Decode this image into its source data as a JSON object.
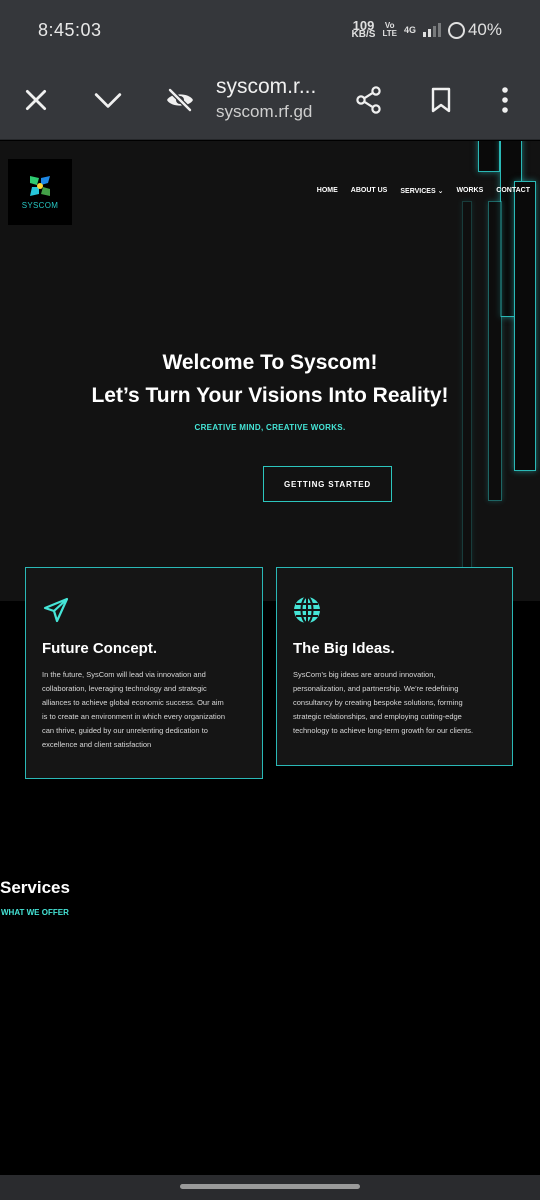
{
  "status_bar": {
    "time": "8:45:03",
    "speed_value": "109",
    "speed_unit": "KB/S",
    "volte_top": "Vo",
    "volte_bottom": "LTE",
    "network": "4G",
    "battery": "40%"
  },
  "browser": {
    "page_title": "syscom.r...",
    "host": "syscom.rf.gd",
    "icons": [
      "close-icon",
      "chevron-down-icon",
      "eye-off-icon",
      "share-icon",
      "bookmark-icon",
      "more-vert-icon"
    ]
  },
  "site": {
    "logo_text": "SYSCOM",
    "nav": [
      "HOME",
      "ABOUT US",
      "SERVICES ⌄",
      "WORKS",
      "CONTACT"
    ],
    "hero": {
      "line1": "Welcome To Syscom!",
      "line2": "Let’s Turn Your Visions Into Reality!",
      "tagline": "CREATIVE MIND, CREATIVE WORKS.",
      "cta": "GETTING STARTED"
    },
    "cards": [
      {
        "icon": "paper-plane-icon",
        "title": "Future Concept.",
        "lines": [
          "In the future, SysCom will lead via innovation and",
          "collaboration, leveraging technology and strategic",
          "alliances to achieve global economic success. Our aim",
          "is to create an environment in which every organization",
          "can thrive, guided by our unrelenting dedication to",
          "excellence and client satisfaction"
        ]
      },
      {
        "icon": "globe-icon",
        "title": "The Big Ideas.",
        "lines": [
          "SysCom’s big ideas are around innovation,",
          "personalization, and partnership. We’re redefining",
          "consultancy by creating bespoke solutions, forming",
          "strategic relationships, and employing cutting-edge",
          "technology to achieve long-term growth for our clients."
        ]
      }
    ],
    "services_title": "Services",
    "services_subtitle": "WHAT WE OFFER"
  },
  "colors": {
    "accent": "#45e5d7",
    "card_border": "#2ab8b6",
    "chrome": "#35373b"
  }
}
